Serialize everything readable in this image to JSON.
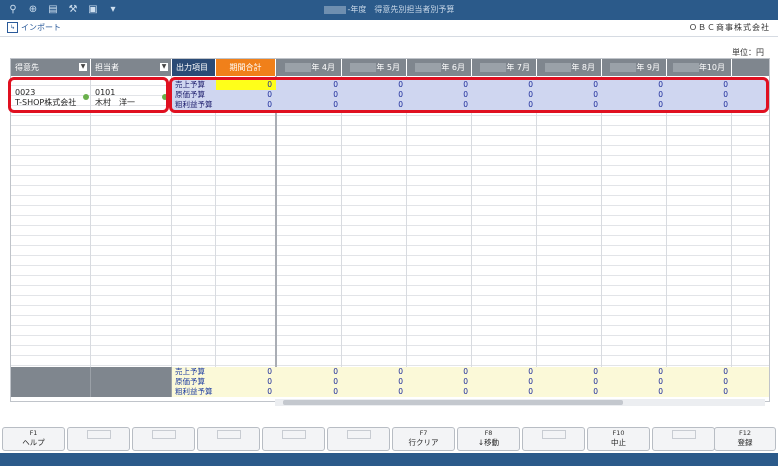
{
  "window": {
    "title": "-年度　得意先別担当者別予算"
  },
  "toolbar": {
    "import_label": "インポート",
    "company": "ＯＢＣ商事株式会社"
  },
  "unit_label": "単位：円",
  "grid": {
    "col_customer": "得意先",
    "col_staff": "担当者",
    "col_output": "出力項目",
    "col_total": "期間合計",
    "months": [
      "年 4月",
      "年 5月",
      "年 6月",
      "年 7月",
      "年 8月",
      "年 9月",
      "年10月"
    ],
    "customer_code": "0023",
    "customer_name": "T-SHOP株式会社",
    "staff_code": "0101",
    "staff_name": "木村　洋一",
    "rows": [
      {
        "label": "売上予算",
        "total": "0",
        "values": [
          "0",
          "0",
          "0",
          "0",
          "0",
          "0",
          "0"
        ]
      },
      {
        "label": "原価予算",
        "total": "0",
        "values": [
          "0",
          "0",
          "0",
          "0",
          "0",
          "0",
          "0"
        ]
      },
      {
        "label": "粗利益予算",
        "total": "0",
        "values": [
          "0",
          "0",
          "0",
          "0",
          "0",
          "0",
          "0"
        ]
      }
    ],
    "totals": [
      {
        "label": "売上予算",
        "total": "0",
        "values": [
          "0",
          "0",
          "0",
          "0",
          "0",
          "0",
          "0"
        ]
      },
      {
        "label": "原価予算",
        "total": "0",
        "values": [
          "0",
          "0",
          "0",
          "0",
          "0",
          "0",
          "0"
        ]
      },
      {
        "label": "粗利益予算",
        "total": "0",
        "values": [
          "0",
          "0",
          "0",
          "0",
          "0",
          "0",
          "0"
        ]
      }
    ]
  },
  "fkeys": [
    {
      "key": "F1",
      "label": "ヘルプ"
    },
    {
      "key": "",
      "label": ""
    },
    {
      "key": "",
      "label": ""
    },
    {
      "key": "",
      "label": ""
    },
    {
      "key": "",
      "label": ""
    },
    {
      "key": "",
      "label": ""
    },
    {
      "key": "F7",
      "label": "行クリア"
    },
    {
      "key": "F8",
      "label": "↓移動"
    },
    {
      "key": "",
      "label": ""
    },
    {
      "key": "F10",
      "label": "中止"
    },
    {
      "key": "",
      "label": ""
    },
    {
      "key": "F12",
      "label": "登録"
    }
  ],
  "colors": {
    "titlebar": "#2b5a8a",
    "header_gray": "#7f868e",
    "header_orange": "#f0801a",
    "highlight_red": "#e01020",
    "input_yellow": "#ffff1a"
  }
}
